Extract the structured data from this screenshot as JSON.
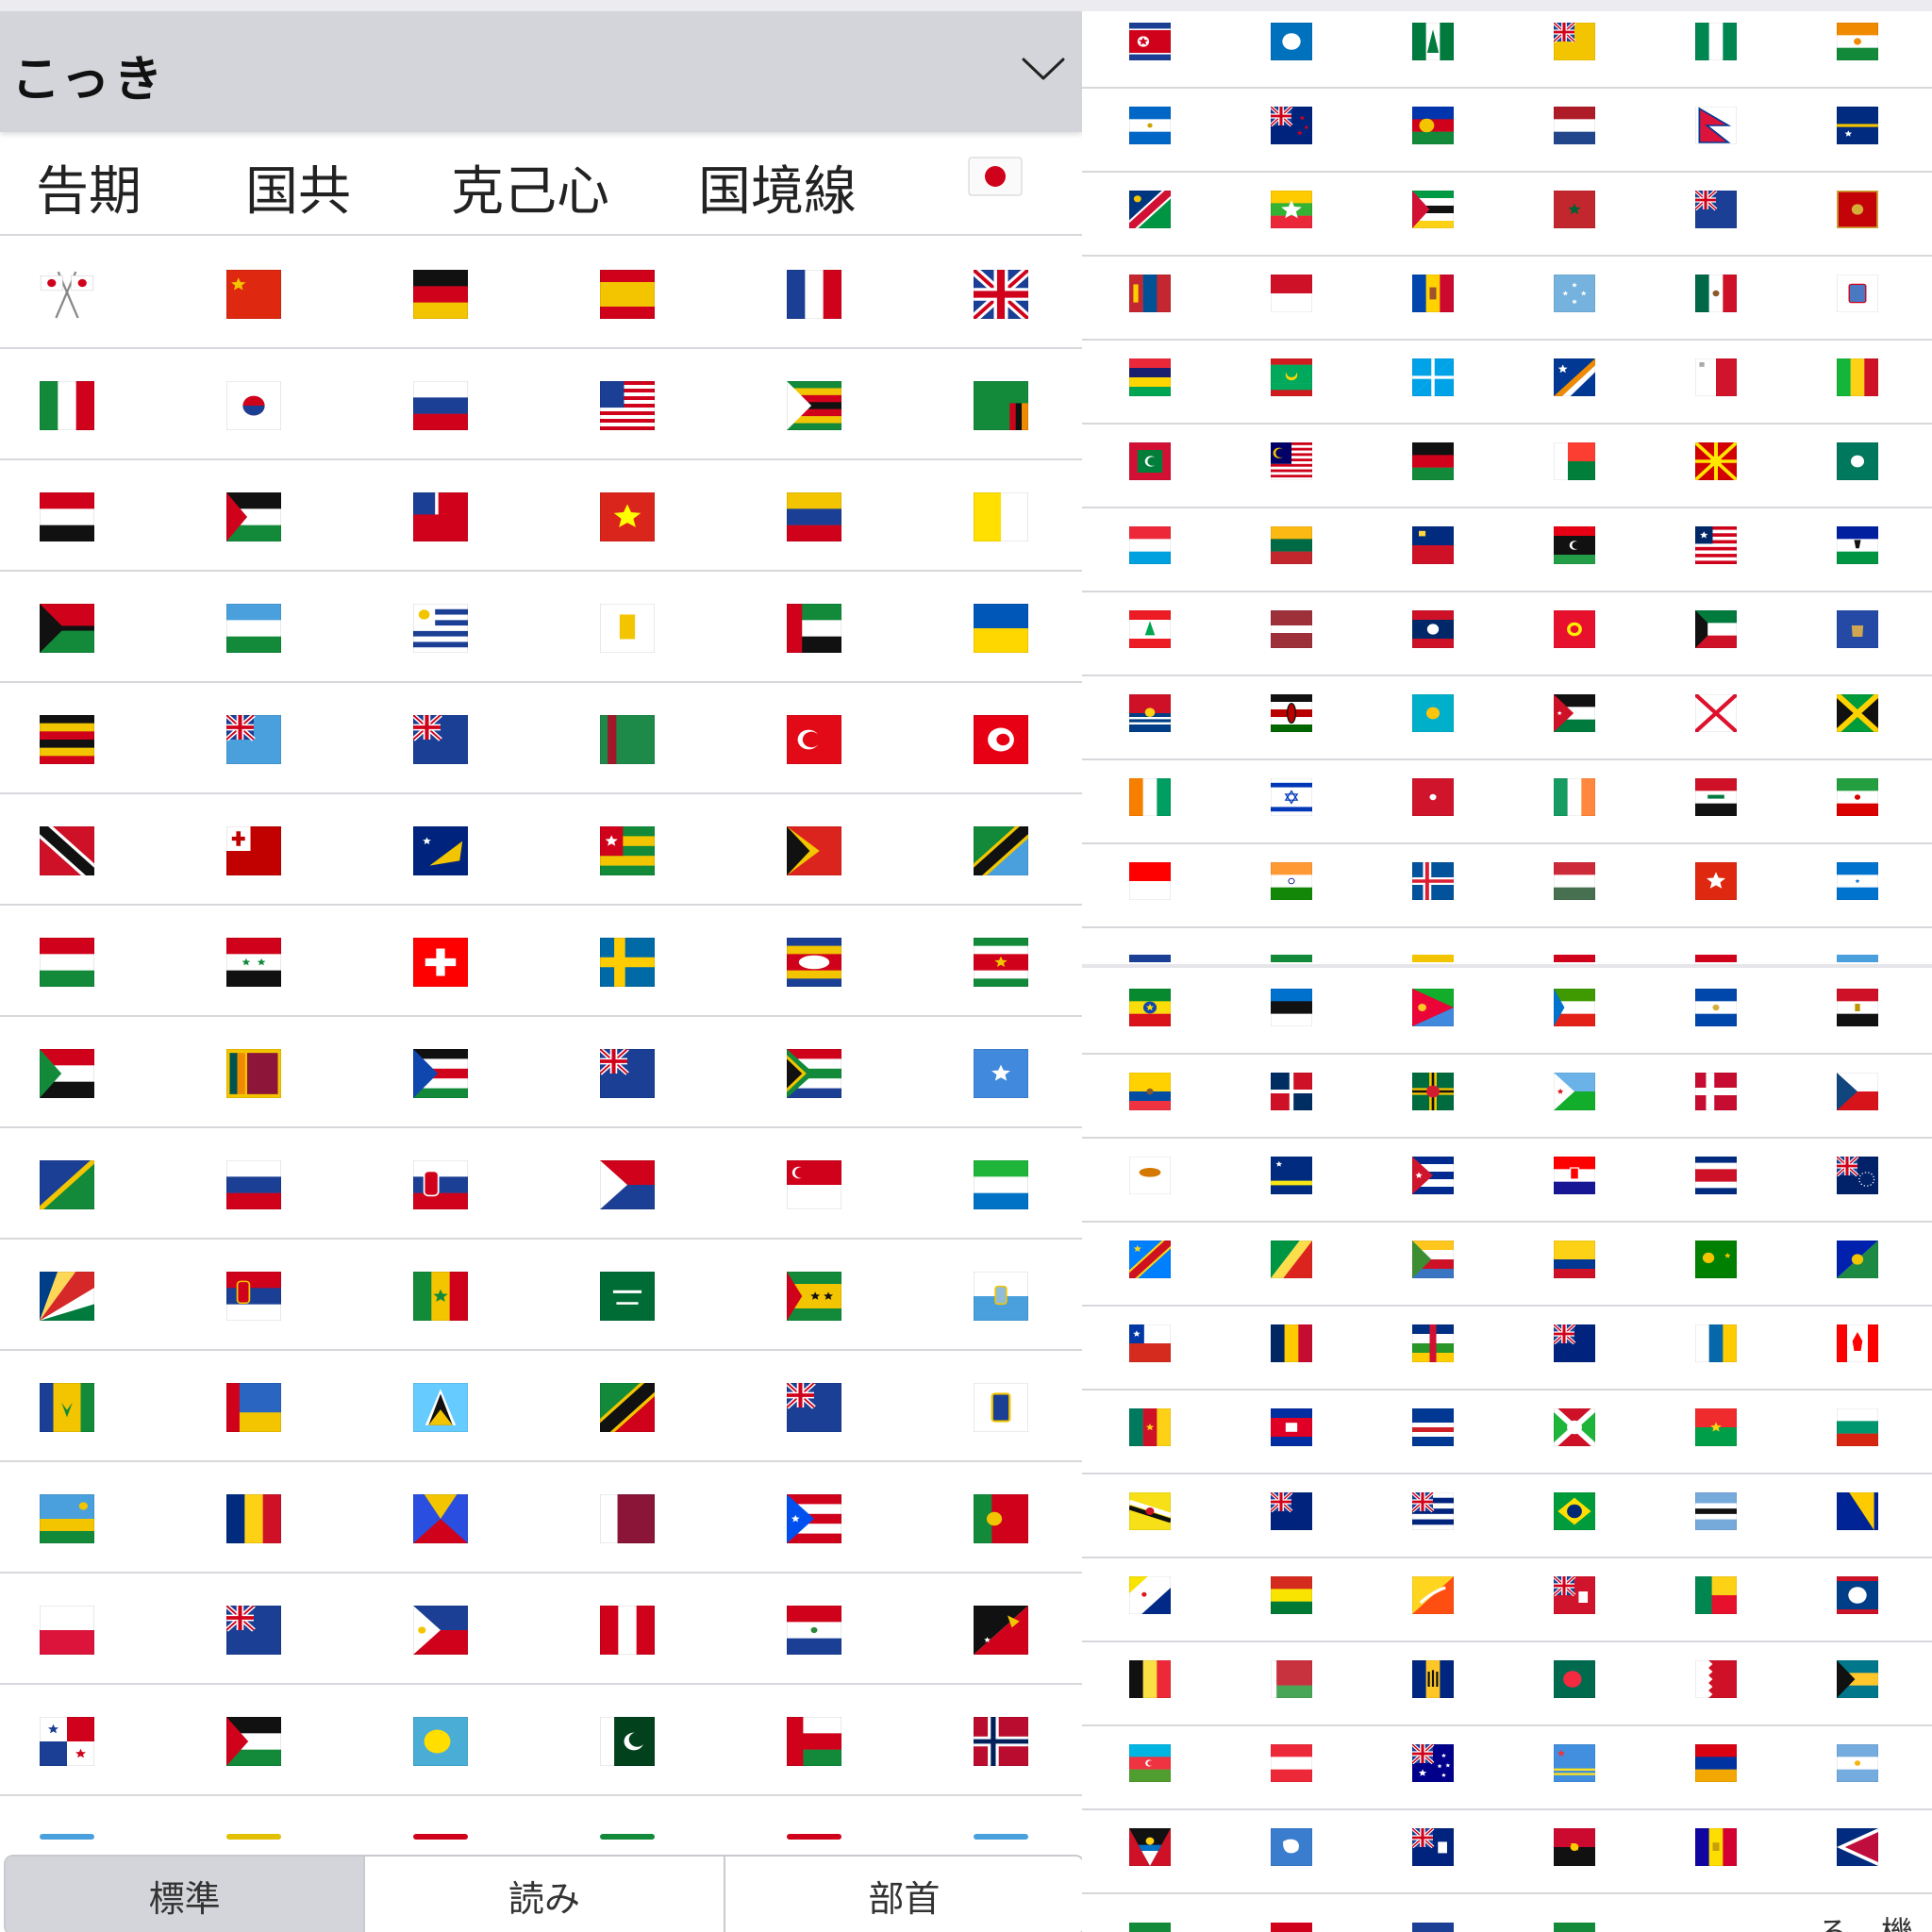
{
  "keyboard": {
    "reading": "こっき",
    "candidates": [
      "告期",
      "国共",
      "克己心",
      "国境線"
    ],
    "candidate_emoji": "flag-japan",
    "tabs": [
      {
        "label": "標準",
        "active": true
      },
      {
        "label": "読み",
        "active": false
      },
      {
        "label": "部首",
        "active": false
      }
    ]
  },
  "right_peek": {
    "text": "ろ　機"
  },
  "flags_left": [
    [
      "crossed-flags",
      "flag-china",
      "flag-germany",
      "flag-spain",
      "flag-france",
      "flag-united-kingdom"
    ],
    [
      "flag-italy",
      "flag-south-korea",
      "flag-russia",
      "flag-united-states",
      "flag-zimbabwe",
      "flag-zambia"
    ],
    [
      "flag-yemen",
      "flag-western-sahara",
      "flag-wallis-futuna",
      "flag-vietnam",
      "flag-venezuela",
      "flag-vatican-city"
    ],
    [
      "flag-vanuatu",
      "flag-uzbekistan",
      "flag-uruguay",
      "flag-us-virgin-islands",
      "flag-uae",
      "flag-ukraine"
    ],
    [
      "flag-uganda",
      "flag-tuvalu",
      "flag-turks-caicos",
      "flag-turkmenistan",
      "flag-turkey",
      "flag-tunisia"
    ],
    [
      "flag-trinidad-tobago",
      "flag-tonga",
      "flag-tokelau",
      "flag-togo",
      "flag-timor-leste",
      "flag-tanzania"
    ],
    [
      "flag-tajikistan",
      "flag-syria",
      "flag-switzerland",
      "flag-sweden",
      "flag-eswatini",
      "flag-suriname"
    ],
    [
      "flag-sudan",
      "flag-sri-lanka",
      "flag-south-sudan",
      "flag-south-georgia",
      "flag-south-africa",
      "flag-somalia"
    ],
    [
      "flag-solomon-islands",
      "flag-slovenia",
      "flag-slovakia",
      "flag-sint-maarten",
      "flag-singapore",
      "flag-sierra-leone"
    ],
    [
      "flag-seychelles",
      "flag-serbia",
      "flag-senegal",
      "flag-saudi-arabia",
      "flag-sao-tome-principe",
      "flag-san-marino"
    ],
    [
      "flag-st-vincent-grenadines",
      "flag-st-pierre-miquelon",
      "flag-st-lucia",
      "flag-st-kitts-nevis",
      "flag-st-helena",
      "flag-st-barthelemy"
    ],
    [
      "flag-rwanda",
      "flag-romania",
      "flag-reunion",
      "flag-qatar",
      "flag-puerto-rico",
      "flag-portugal"
    ],
    [
      "flag-poland",
      "flag-pitcairn-islands",
      "flag-philippines",
      "flag-peru",
      "flag-paraguay",
      "flag-papua-new-guinea"
    ],
    [
      "flag-panama",
      "flag-palestine",
      "flag-palau",
      "flag-pakistan",
      "flag-oman",
      "flag-norway"
    ]
  ],
  "flags_right_top": [
    [
      "flag-north-korea",
      "flag-northern-mariana-islands",
      "flag-norfolk-island",
      "flag-niue",
      "flag-nigeria",
      "flag-niger"
    ],
    [
      "flag-nicaragua",
      "flag-new-zealand",
      "flag-new-caledonia",
      "flag-netherlands",
      "flag-nepal",
      "flag-nauru"
    ],
    [
      "flag-namibia",
      "flag-myanmar",
      "flag-mozambique",
      "flag-morocco",
      "flag-montserrat",
      "flag-montenegro"
    ],
    [
      "flag-mongolia",
      "flag-monaco",
      "flag-moldova",
      "flag-micronesia",
      "flag-mexico",
      "flag-mayotte"
    ],
    [
      "flag-mauritius",
      "flag-mauritania",
      "flag-martinique",
      "flag-marshall-islands",
      "flag-malta",
      "flag-mali"
    ],
    [
      "flag-maldives",
      "flag-malaysia",
      "flag-malawi",
      "flag-madagascar",
      "flag-north-macedonia",
      "flag-macao"
    ],
    [
      "flag-luxembourg",
      "flag-lithuania",
      "flag-liechtenstein",
      "flag-libya",
      "flag-liberia",
      "flag-lesotho"
    ],
    [
      "flag-lebanon",
      "flag-latvia",
      "flag-laos",
      "flag-kyrgyzstan",
      "flag-kuwait",
      "flag-kosovo"
    ],
    [
      "flag-kiribati",
      "flag-kenya",
      "flag-kazakhstan",
      "flag-jordan",
      "flag-jersey",
      "flag-jamaica"
    ],
    [
      "flag-cote-divoire",
      "flag-israel",
      "flag-isle-of-man",
      "flag-ireland",
      "flag-iraq",
      "flag-iran"
    ],
    [
      "flag-indonesia",
      "flag-india",
      "flag-iceland",
      "flag-hungary",
      "flag-hong-kong",
      "flag-honduras"
    ]
  ],
  "flags_right_bottom": [
    [
      "flag-ethiopia",
      "flag-estonia",
      "flag-eritrea",
      "flag-equatorial-guinea",
      "flag-el-salvador",
      "flag-egypt"
    ],
    [
      "flag-ecuador",
      "flag-dominican-republic",
      "flag-dominica",
      "flag-djibouti",
      "flag-denmark",
      "flag-czechia"
    ],
    [
      "flag-cyprus",
      "flag-curacao",
      "flag-cuba",
      "flag-croatia",
      "flag-costa-rica",
      "flag-cook-islands"
    ],
    [
      "flag-congo-kinshasa",
      "flag-congo-brazzaville",
      "flag-comoros",
      "flag-colombia",
      "flag-cocos-islands",
      "flag-christmas-island"
    ],
    [
      "flag-chile",
      "flag-chad",
      "flag-central-african-republic",
      "flag-cayman-islands",
      "flag-canary-islands",
      "flag-canada"
    ],
    [
      "flag-cameroon",
      "flag-cambodia",
      "flag-cape-verde",
      "flag-burundi",
      "flag-burkina-faso",
      "flag-bulgaria"
    ],
    [
      "flag-brunei",
      "flag-british-virgin-islands",
      "flag-british-indian-ocean-territory",
      "flag-brazil",
      "flag-botswana",
      "flag-bosnia"
    ],
    [
      "flag-bonaire",
      "flag-bolivia",
      "flag-bhutan",
      "flag-bermuda",
      "flag-benin",
      "flag-belize"
    ],
    [
      "flag-belgium",
      "flag-belarus",
      "flag-barbados",
      "flag-bangladesh",
      "flag-bahrain",
      "flag-bahamas"
    ],
    [
      "flag-azerbaijan",
      "flag-austria",
      "flag-australia",
      "flag-aruba",
      "flag-armenia",
      "flag-argentina"
    ],
    [
      "flag-antigua-barbuda",
      "flag-antarctica",
      "flag-anguilla",
      "flag-angola",
      "flag-andorra",
      "flag-american-samoa"
    ]
  ],
  "palette": {
    "header_bg": "#d4d5da",
    "divider": "#d8d8dc",
    "active_tab": "#d4d5da"
  }
}
